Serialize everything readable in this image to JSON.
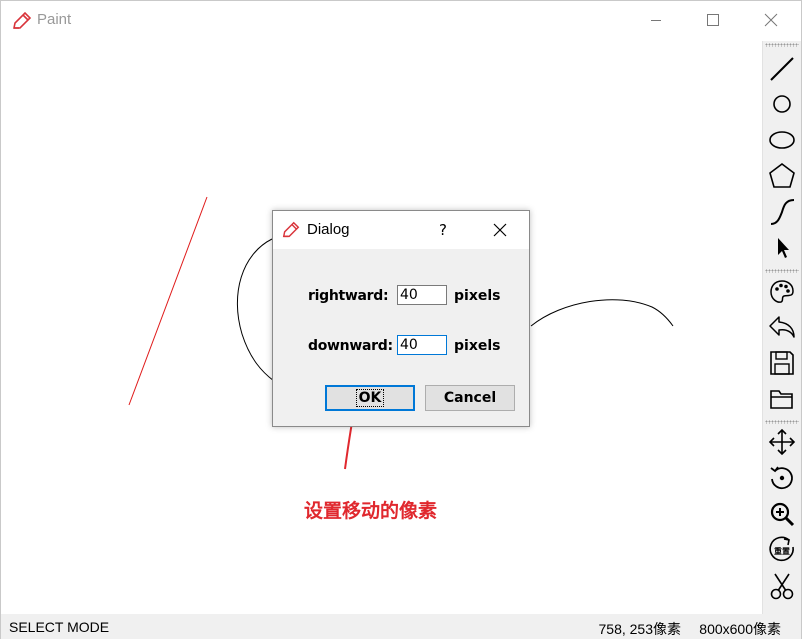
{
  "window": {
    "title": "Paint",
    "accent_color": "#d9343b"
  },
  "toolbar": {
    "tools": [
      {
        "name": "line-icon"
      },
      {
        "name": "circle-icon"
      },
      {
        "name": "ellipse-icon"
      },
      {
        "name": "polygon-icon"
      },
      {
        "name": "curve-icon"
      },
      {
        "name": "select-cursor-icon"
      },
      {
        "name": "palette-icon"
      },
      {
        "name": "undo-icon"
      },
      {
        "name": "save-icon"
      },
      {
        "name": "open-folder-icon"
      },
      {
        "name": "move-icon"
      },
      {
        "name": "rotate-icon"
      },
      {
        "name": "zoom-in-icon"
      },
      {
        "name": "redo-reset-icon",
        "label": "重置"
      },
      {
        "name": "scissors-icon"
      }
    ]
  },
  "canvas": {
    "stroke_colors": {
      "line": "#e01b1b",
      "shapes": "#000000"
    }
  },
  "dialog": {
    "title": "Dialog",
    "help_label": "?",
    "fields": [
      {
        "label": "rightward:",
        "value": "40",
        "unit": "pixels"
      },
      {
        "label": "downward:",
        "value": "40",
        "unit": "pixels"
      }
    ],
    "ok_label": "OK",
    "cancel_label": "Cancel"
  },
  "annotation": {
    "text": "设置移动的像素",
    "color": "#e0282e"
  },
  "status": {
    "mode": "SELECT MODE",
    "coords": "758, 253像素",
    "size": "800x600像素"
  }
}
